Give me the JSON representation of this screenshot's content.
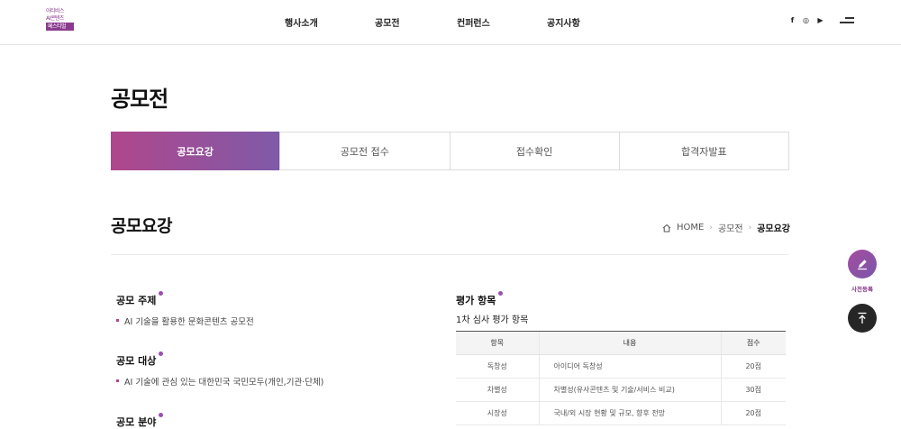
{
  "logo": {
    "line1": "아티비스",
    "line2": "AI콘텐츠",
    "line3": "페스티벌"
  },
  "nav": [
    "행사소개",
    "공모전",
    "컨퍼런스",
    "공지사항"
  ],
  "social": [
    "f",
    "◎",
    "▶"
  ],
  "page_title": "공모전",
  "tabs": [
    "공모요강",
    "공모전 접수",
    "접수확인",
    "합격자발표"
  ],
  "section_title": "공모요강",
  "breadcrumb": {
    "home": "HOME",
    "level1": "공모전",
    "current": "공모요강"
  },
  "blocks": [
    {
      "title": "공모 주제",
      "body": "AI 기술을 활용한 문화콘텐츠 공모전"
    },
    {
      "title": "공모 대상",
      "body": "AI 기술에 관심 있는 대한민국 국민모두(개인,기관·단체)"
    },
    {
      "title": "공모 분야",
      "body": ""
    }
  ],
  "evaluation": {
    "title": "평가 항목",
    "subtitle": "1차 심사 평가 항목",
    "headers": [
      "항목",
      "내용",
      "점수"
    ],
    "rows": [
      {
        "item": "독창성",
        "content": "아이디어 독창성",
        "score": "20점"
      },
      {
        "item": "차별성",
        "content": "차별성(유사콘텐츠 및 기술/서비스 비교)",
        "score": "30점"
      },
      {
        "item": "시장성",
        "content": "국내/외 시장 현황 및 규모, 향후 전망",
        "score": "20점"
      }
    ]
  },
  "float": {
    "register_label": "사전등록"
  },
  "colors": {
    "accent": "#9b4fb0",
    "brand": "#8a3b8f",
    "tab_gradient_start": "#b0478c",
    "tab_gradient_end": "#7f5aa8"
  }
}
